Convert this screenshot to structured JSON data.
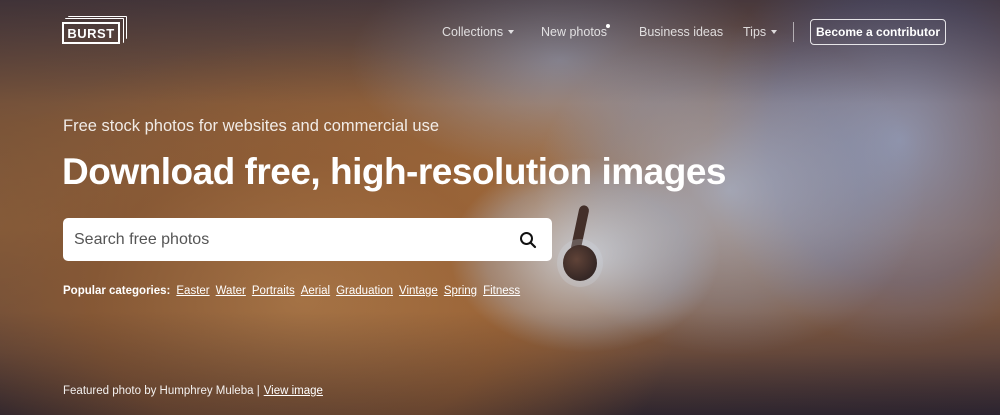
{
  "brand": {
    "logo_text": "BURST"
  },
  "nav": {
    "items": [
      {
        "label": "Collections",
        "has_dropdown": true
      },
      {
        "label": "New photos",
        "has_dot": true
      },
      {
        "label": "Business ideas"
      },
      {
        "label": "Tips",
        "has_dropdown": true
      }
    ],
    "cta_label": "Become a contributor"
  },
  "hero": {
    "tagline": "Free stock photos for websites and commercial use",
    "headline": "Download free, high-resolution images"
  },
  "search": {
    "placeholder": "Search free photos"
  },
  "categories": {
    "label": "Popular categories:",
    "items": [
      "Easter",
      "Water",
      "Portraits",
      "Aerial",
      "Graduation",
      "Vintage",
      "Spring",
      "Fitness"
    ]
  },
  "credit": {
    "text": "Featured photo by Humphrey Muleba |",
    "link": "View image"
  },
  "colors": {
    "text": "#ffffff",
    "search_bg": "#ffffff",
    "sand": "#b97d43",
    "wave": "#c8d8f5"
  }
}
